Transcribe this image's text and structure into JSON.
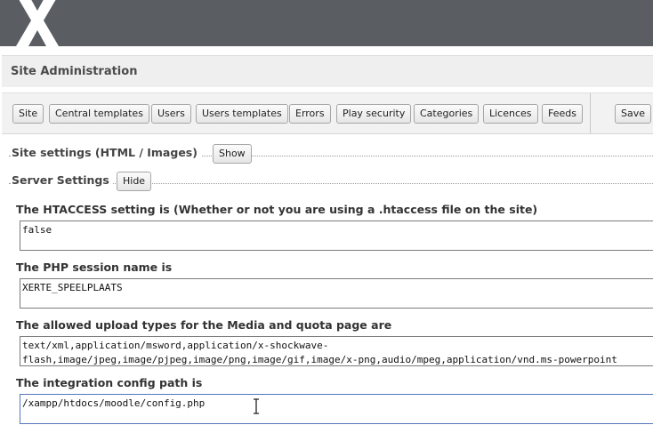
{
  "header": {
    "title": "Site Administration"
  },
  "toolbar": {
    "buttons": [
      "Site",
      "Central templates",
      "Users",
      "Users templates",
      "Errors",
      "Play security",
      "Categories",
      "Licences",
      "Feeds"
    ],
    "save_label": "Save"
  },
  "sections": {
    "site_settings": {
      "label": "Site settings (HTML / Images)",
      "toggle": "Show"
    },
    "server_settings": {
      "label": "Server Settings",
      "toggle": "Hide"
    }
  },
  "fields": [
    {
      "label": "The HTACCESS setting is (Whether or not you are using a .htaccess file on the site)",
      "value": "false"
    },
    {
      "label": "The PHP session name is",
      "value": "XERTE_SPEELPLAATS"
    },
    {
      "label": "The allowed upload types for the Media and quota page are",
      "value": "text/xml,application/msword,application/x-shockwave-\nflash,image/jpeg,image/pjpeg,image/png,image/gif,image/x-png,audio/mpeg,application/vnd.ms-powerpoint"
    },
    {
      "label": "The integration config path is",
      "value": "/xampp/htdocs/moodle/config.php"
    }
  ]
}
